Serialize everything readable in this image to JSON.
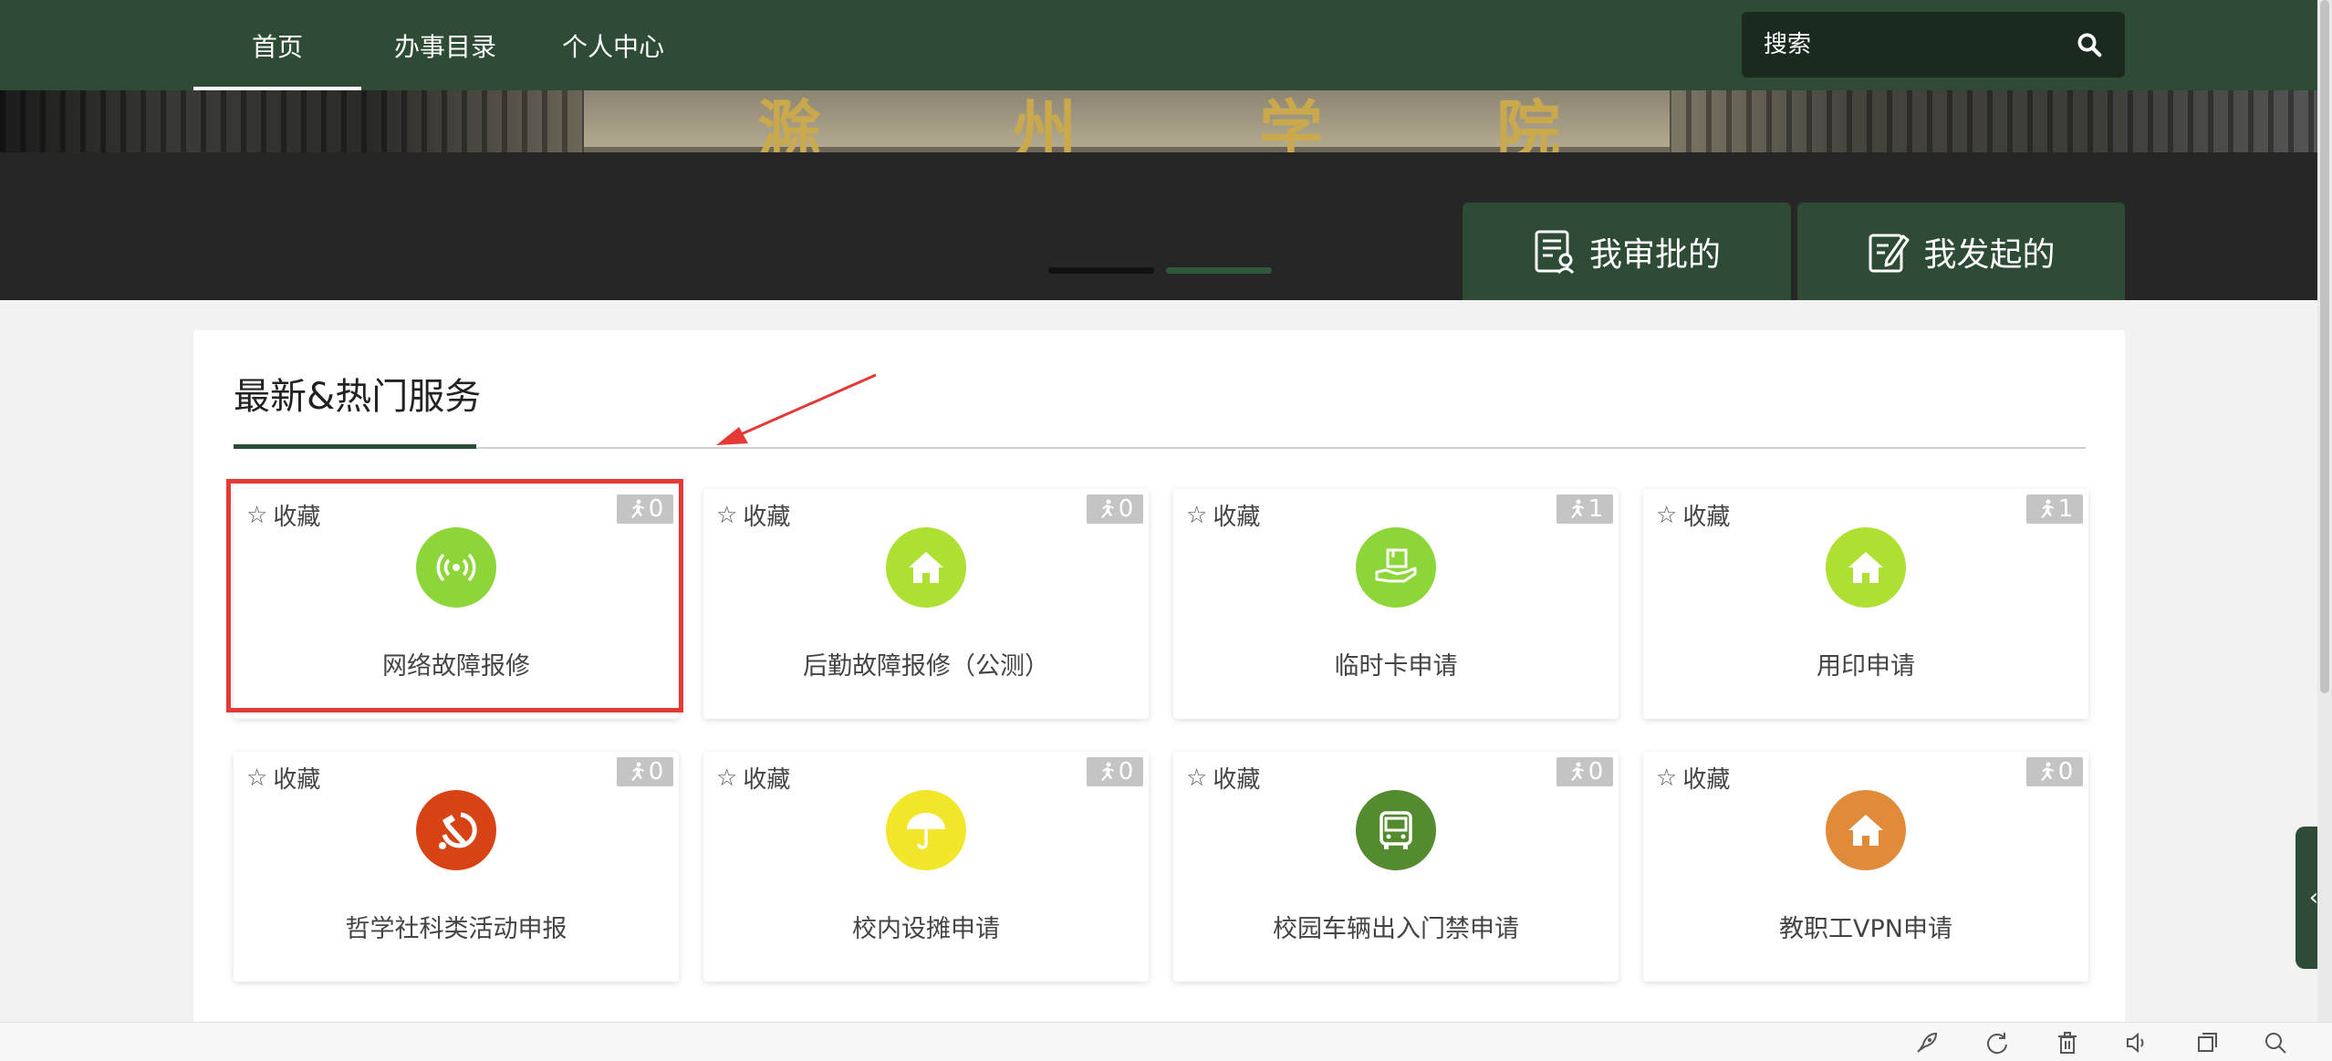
{
  "nav": {
    "tabs": [
      {
        "label": "首页",
        "active": true
      },
      {
        "label": "办事目录",
        "active": false
      },
      {
        "label": "个人中心",
        "active": false
      }
    ],
    "search_placeholder": "搜索",
    "search_icon": "search-icon"
  },
  "banner": {
    "plaque_chars": [
      "滁",
      "州",
      "学",
      "院"
    ],
    "quick_actions": [
      {
        "label": "我审批的",
        "icon": "approval-list-icon"
      },
      {
        "label": "我发起的",
        "icon": "edit-document-icon"
      }
    ]
  },
  "section": {
    "title": "最新&热门服务"
  },
  "services": [
    {
      "name": "网络故障报修",
      "fav_label": "收藏",
      "count": "0",
      "icon": "wifi-signal-icon",
      "color": "#8dd63a",
      "highlighted": true
    },
    {
      "name": "后勤故障报修（公测）",
      "fav_label": "收藏",
      "count": "0",
      "icon": "home-icon",
      "color": "#aee033"
    },
    {
      "name": "临时卡申请",
      "fav_label": "收藏",
      "count": "1",
      "icon": "card-hand-icon",
      "color": "#8dd63a"
    },
    {
      "name": "用印申请",
      "fav_label": "收藏",
      "count": "1",
      "icon": "home-icon",
      "color": "#aee033"
    },
    {
      "name": "哲学社科类活动申报",
      "fav_label": "收藏",
      "count": "0",
      "icon": "hammer-sickle-icon",
      "color": "#d84315"
    },
    {
      "name": "校内设摊申请",
      "fav_label": "收藏",
      "count": "0",
      "icon": "umbrella-icon",
      "color": "#f2e62a"
    },
    {
      "name": "校园车辆出入门禁申请",
      "fav_label": "收藏",
      "count": "0",
      "icon": "bus-icon",
      "color": "#558b2f"
    },
    {
      "name": "教职工VPN申请",
      "fav_label": "收藏",
      "count": "0",
      "icon": "home-icon",
      "color": "#e08b3a"
    }
  ],
  "side_tab_icon": "chevron-left-icon",
  "bottom_toolbar": [
    "rocket-icon",
    "refresh-icon",
    "trash-icon",
    "speaker-icon",
    "window-icon",
    "search-icon"
  ]
}
